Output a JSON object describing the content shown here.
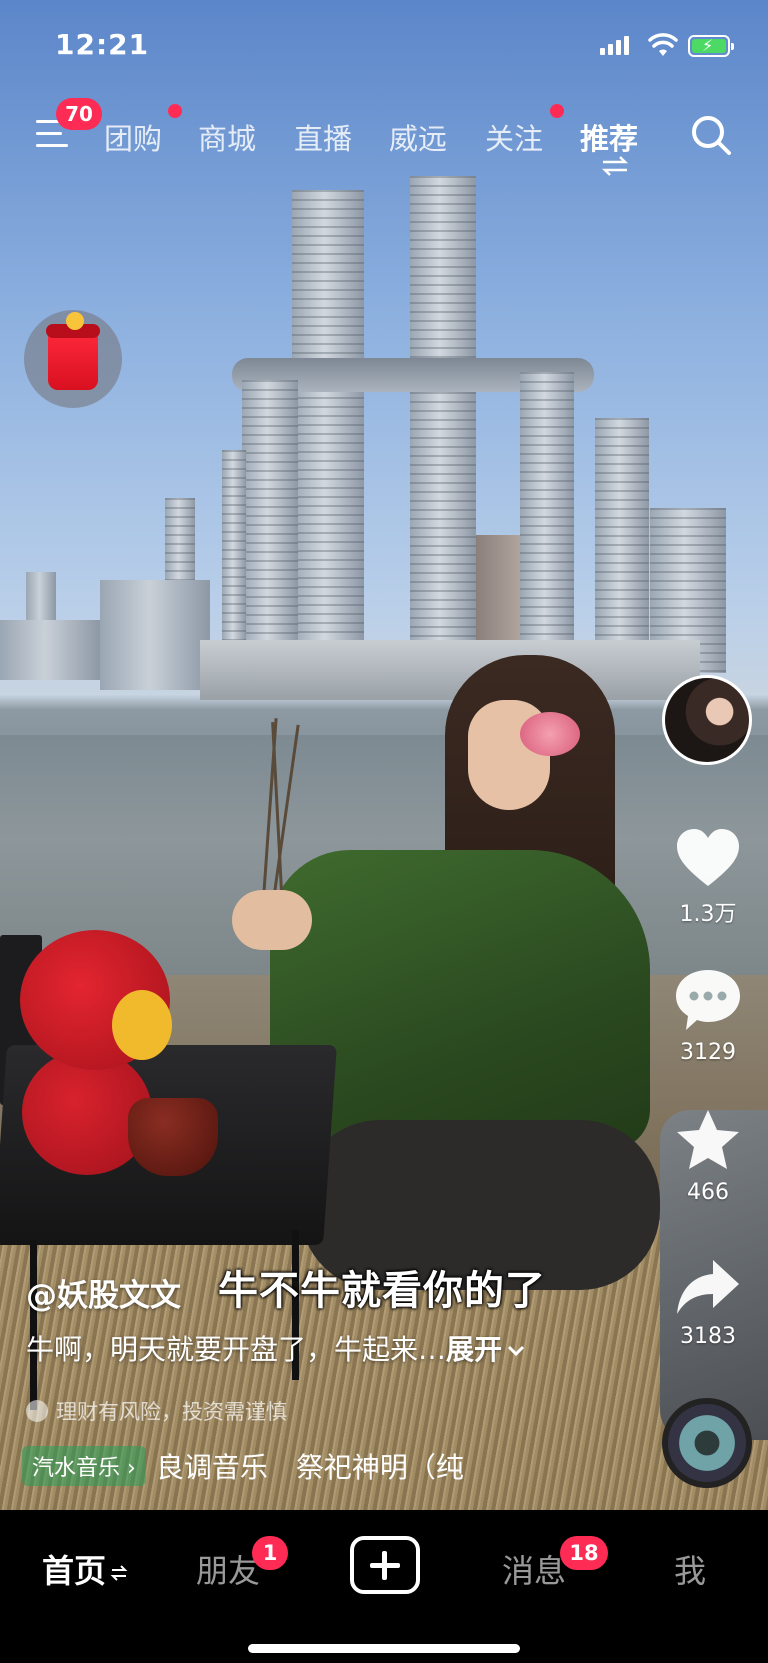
{
  "status_bar": {
    "time": "12:21"
  },
  "top_nav": {
    "menu_badge": "70",
    "tabs": [
      "团购",
      "商城",
      "直播",
      "威远",
      "关注",
      "推荐"
    ],
    "active_tab": "推荐"
  },
  "video": {
    "author": "@妖股文文",
    "overlay_caption": "牛不牛就看你的了",
    "description": "牛啊，明天就要开盘了，牛起来…",
    "expand_label": "展开",
    "risk_notice": "理财有风险，投资需谨慎",
    "music_tag": "汽水音乐",
    "music_title": "良调音乐　祭祀神明（纯"
  },
  "right_rail": {
    "likes": "1.3万",
    "comments": "3129",
    "favorites": "466",
    "shares": "3183"
  },
  "bottom_nav": {
    "home": "首页",
    "friends": "朋友",
    "friends_badge": "1",
    "messages": "消息",
    "messages_badge": "18",
    "me": "我"
  },
  "colors": {
    "accent": "#fe2c55",
    "battery": "#4cd964"
  },
  "icons": [
    "menu-icon",
    "search-icon",
    "swap-icon",
    "heart-icon",
    "comment-icon",
    "star-icon",
    "share-icon",
    "chevron-down-icon",
    "plus-icon",
    "red-packet-icon"
  ]
}
